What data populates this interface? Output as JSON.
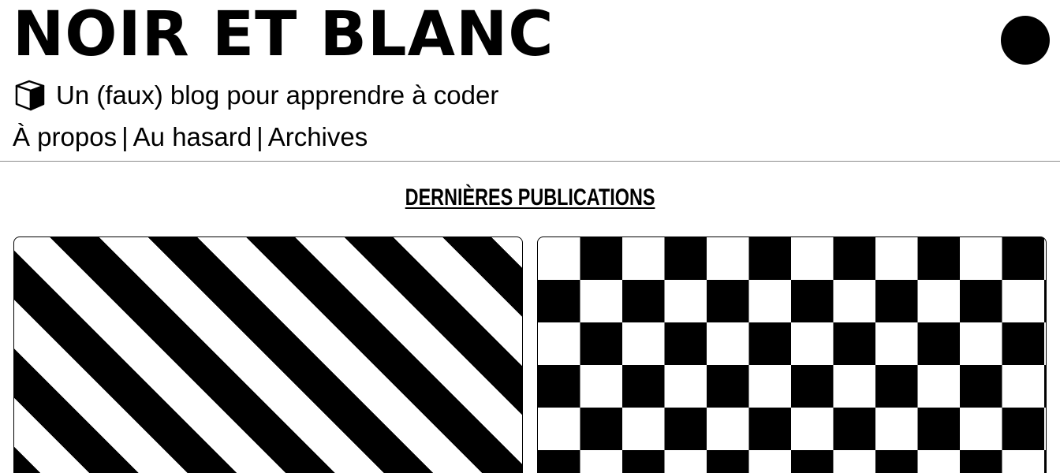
{
  "header": {
    "site_title": "NOIR ET BLANC",
    "tagline": "Un (faux) blog pour apprendre à coder",
    "nav": [
      {
        "label": "À propos"
      },
      {
        "label": "Au hasard"
      },
      {
        "label": "Archives"
      }
    ],
    "nav_separator": "|",
    "icons": {
      "tagline_icon": "cube-icon",
      "theme_toggle": "circle-icon"
    }
  },
  "main": {
    "section_title": "DERNIÈRES PUBLICATIONS",
    "cards": [
      {
        "pattern": "diagonal-stripes"
      },
      {
        "pattern": "checkerboard"
      }
    ]
  },
  "colors": {
    "foreground": "#000000",
    "background": "#ffffff",
    "divider": "#8c8c8c"
  }
}
